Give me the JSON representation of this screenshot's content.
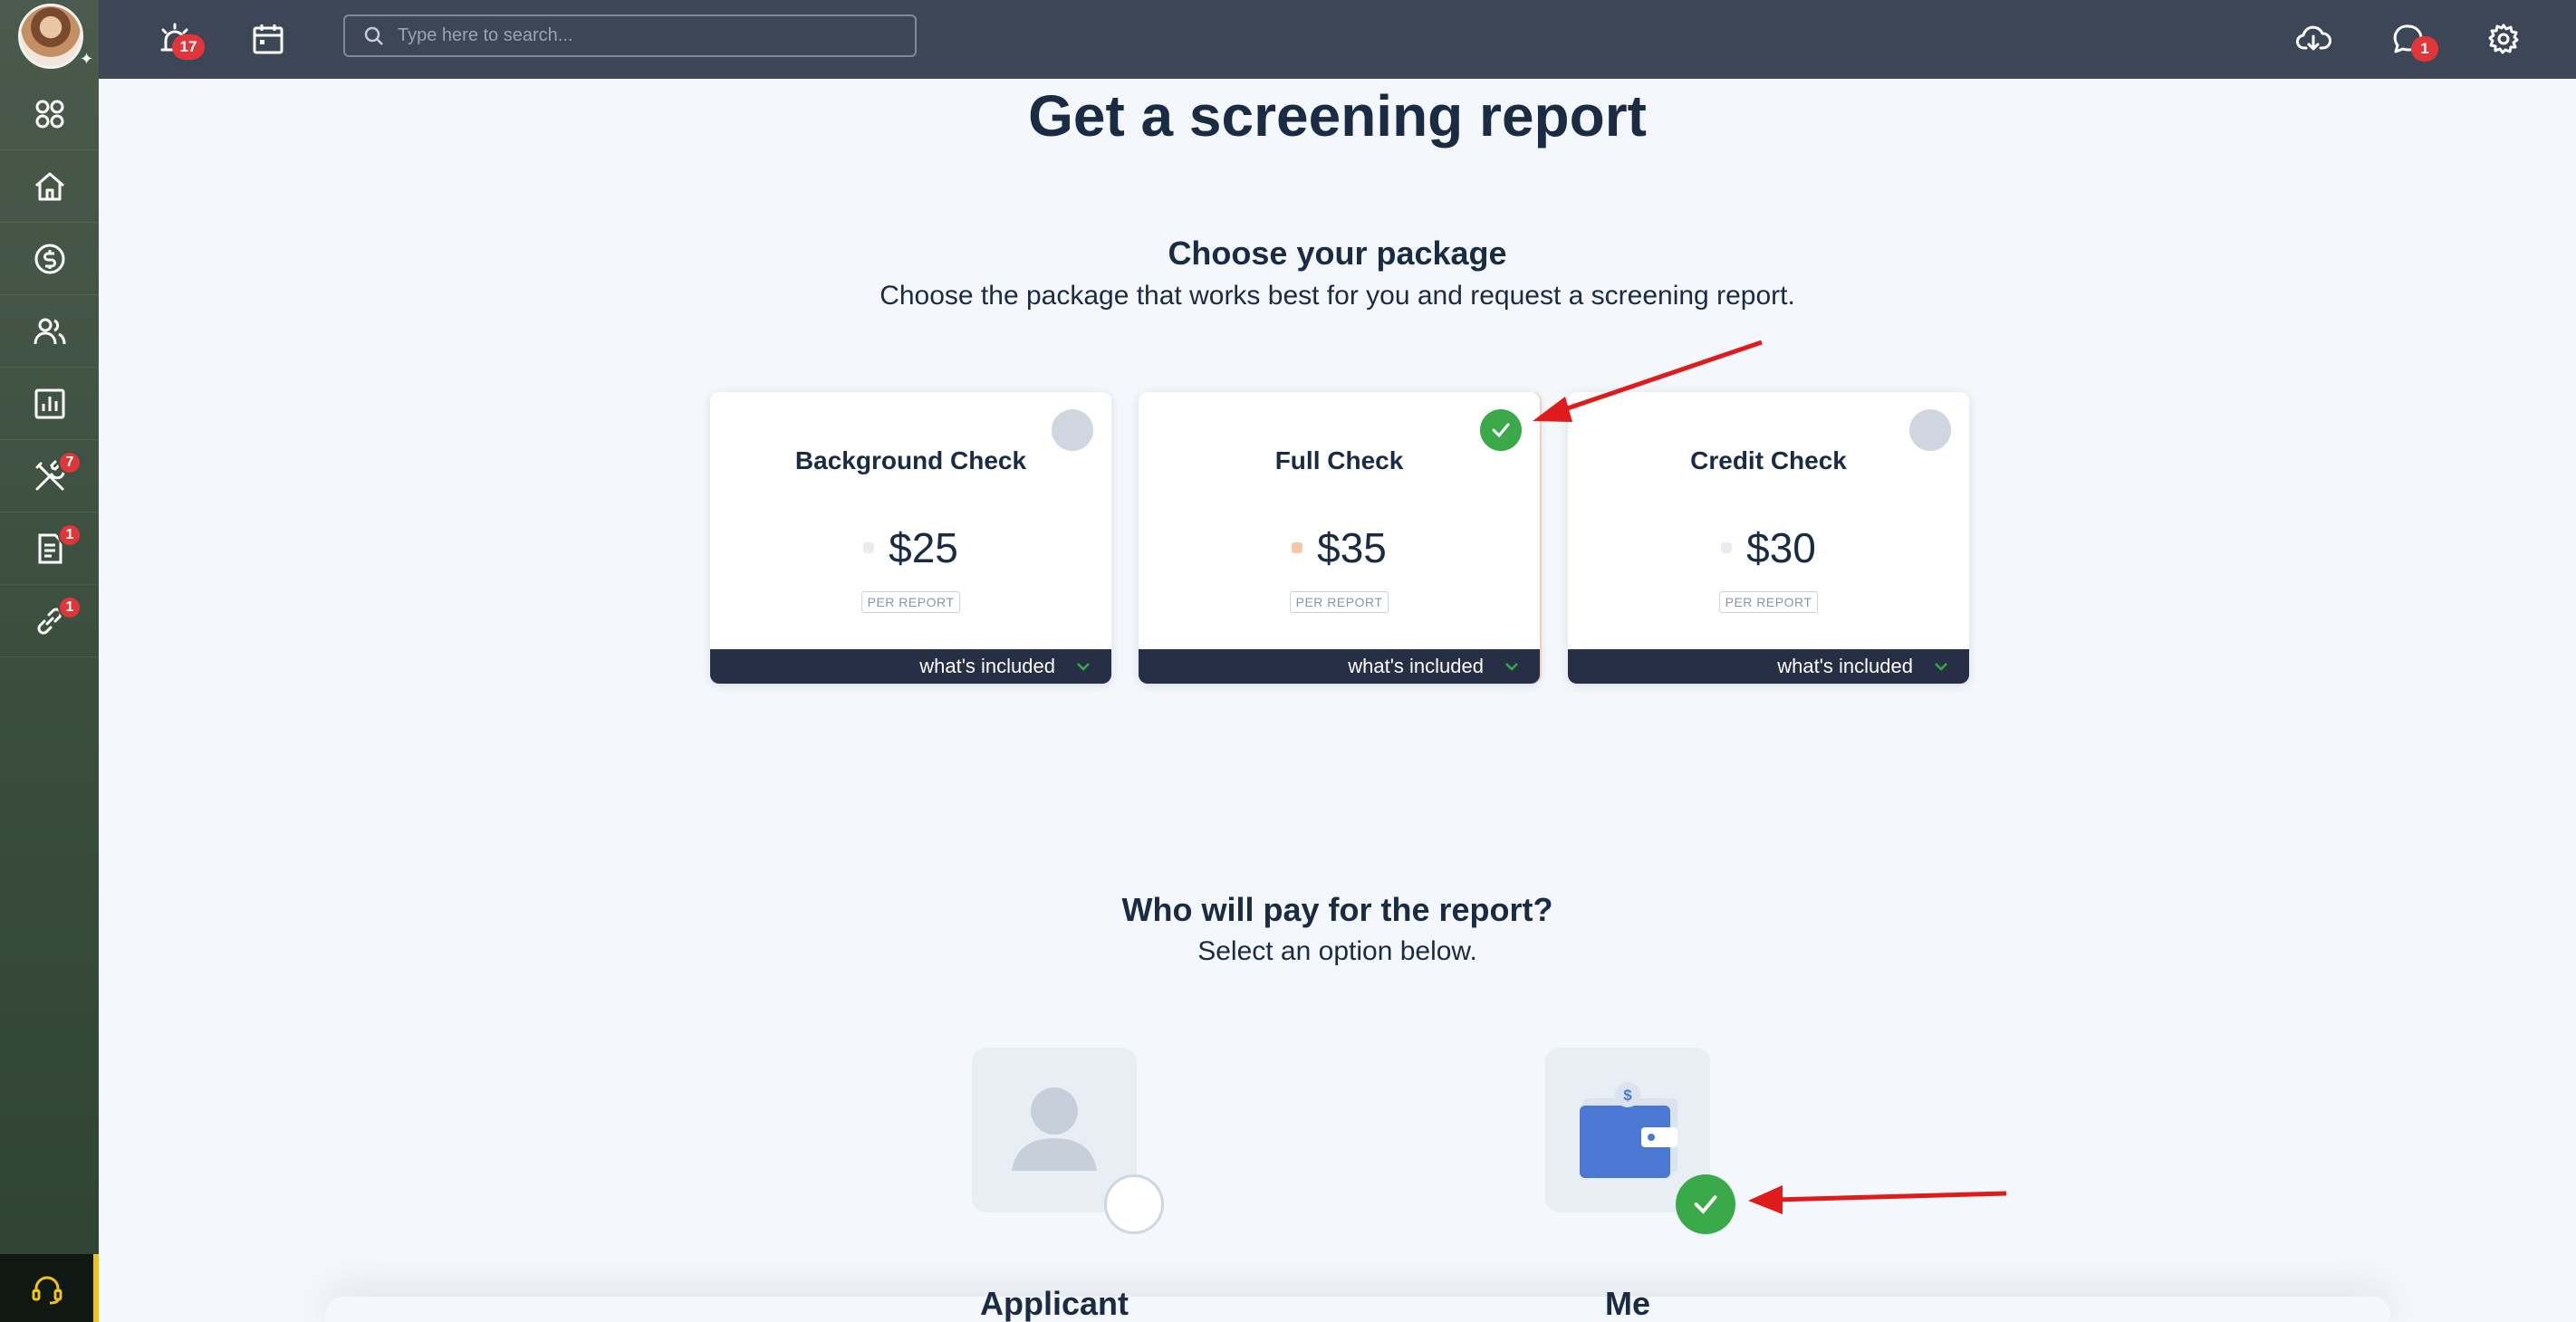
{
  "search": {
    "placeholder": "Type here to search..."
  },
  "topbar": {
    "alerts_badge": "17",
    "messages_badge": "1"
  },
  "sidebar": {
    "items": [
      {
        "name": "apps",
        "badge": ""
      },
      {
        "name": "home",
        "badge": ""
      },
      {
        "name": "payments",
        "badge": ""
      },
      {
        "name": "people",
        "badge": ""
      },
      {
        "name": "reports",
        "badge": ""
      },
      {
        "name": "maintenance",
        "badge": "7"
      },
      {
        "name": "documents",
        "badge": "1"
      },
      {
        "name": "links",
        "badge": "1"
      }
    ]
  },
  "page": {
    "title": "Get a screening report",
    "package_title": "Choose your package",
    "package_sub": "Choose the package that works best for you and request a screening report.",
    "payer_title": "Who will pay for the report?",
    "payer_sub": "Select an option below."
  },
  "packages": [
    {
      "title": "Background Check",
      "price": "$25",
      "per": "PER REPORT",
      "included": "what's included",
      "selected": false
    },
    {
      "title": "Full Check",
      "price": "$35",
      "per": "PER REPORT",
      "included": "what's included",
      "selected": true
    },
    {
      "title": "Credit Check",
      "price": "$30",
      "per": "PER REPORT",
      "included": "what's included",
      "selected": false
    }
  ],
  "payers": [
    {
      "label": "Applicant",
      "selected": false
    },
    {
      "label": "Me",
      "selected": true
    }
  ],
  "colors": {
    "accent_green": "#3aa94a",
    "badge_red": "#e0363a",
    "topbar": "#3c4656",
    "annotation_arrow": "#e01b1b"
  }
}
